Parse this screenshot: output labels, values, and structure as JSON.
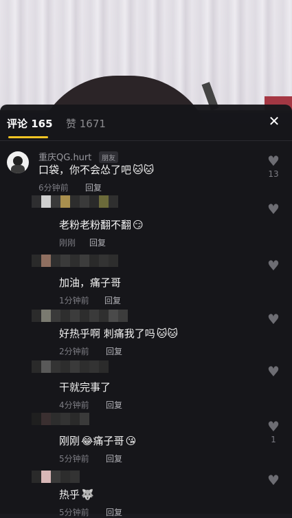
{
  "tabs": {
    "comments_label": "评论 165",
    "likes_label": "赞 1671",
    "close": "✕"
  },
  "comments": [
    {
      "username": "重庆QG.hurt",
      "badge": "朋友",
      "text": "口袋，你不会怂了吧",
      "emojis": "🐱🐱",
      "time": "6分钟前",
      "reply": "回复",
      "likes": "13"
    },
    {
      "text": "老粉老粉翻不翻",
      "emojis": "😏",
      "time": "刚刚",
      "reply": "回复",
      "likes": ""
    },
    {
      "text": "加油，痛子哥",
      "emojis": "",
      "time": "1分钟前",
      "reply": "回复",
      "likes": ""
    },
    {
      "text": "好热乎啊 刺痛我了吗",
      "emojis": "🐱🐱",
      "time": "2分钟前",
      "reply": "回复",
      "likes": ""
    },
    {
      "text": "干就完事了",
      "emojis": "",
      "time": "4分钟前",
      "reply": "回复",
      "likes": ""
    },
    {
      "text_a": "刚刚",
      "emoji_a": "😂",
      "text_b": "痛子哥",
      "emoji_b": "😘",
      "time": "5分钟前",
      "reply": "回复",
      "likes": "1"
    },
    {
      "text": "热乎",
      "emojis": "🐺",
      "time": "5分钟前",
      "reply": "回复",
      "likes": ""
    }
  ],
  "icons": {
    "heart": "heart-icon",
    "close": "close-icon"
  },
  "colors": {
    "accent": "#f3c524",
    "panel_bg": "#16161a",
    "text_primary": "#f2f2f2",
    "text_secondary": "#9a9aa0"
  }
}
